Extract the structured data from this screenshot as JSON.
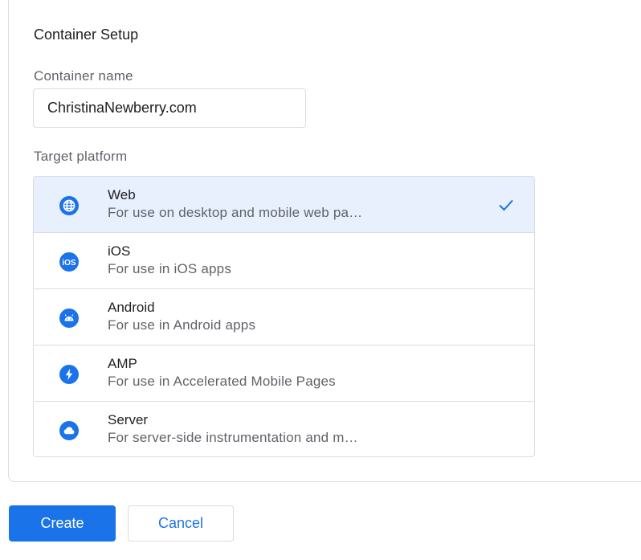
{
  "setup": {
    "section_title": "Container Setup",
    "name_label": "Container name",
    "name_value": "ChristinaNewberry.com",
    "platform_label": "Target platform",
    "selected_platform": "Web",
    "accent_color": "#1a73e8",
    "platforms": [
      {
        "title": "Web",
        "description": "For use on desktop and mobile web pa…",
        "icon": "globe-icon",
        "selected": true
      },
      {
        "title": "iOS",
        "description": "For use in iOS apps",
        "icon": "ios-icon",
        "selected": false
      },
      {
        "title": "Android",
        "description": "For use in Android apps",
        "icon": "android-icon",
        "selected": false
      },
      {
        "title": "AMP",
        "description": "For use in Accelerated Mobile Pages",
        "icon": "amp-bolt-icon",
        "selected": false
      },
      {
        "title": "Server",
        "description": "For server-side instrumentation and m…",
        "icon": "cloud-icon",
        "selected": false
      }
    ]
  },
  "actions": {
    "create_label": "Create",
    "cancel_label": "Cancel"
  }
}
